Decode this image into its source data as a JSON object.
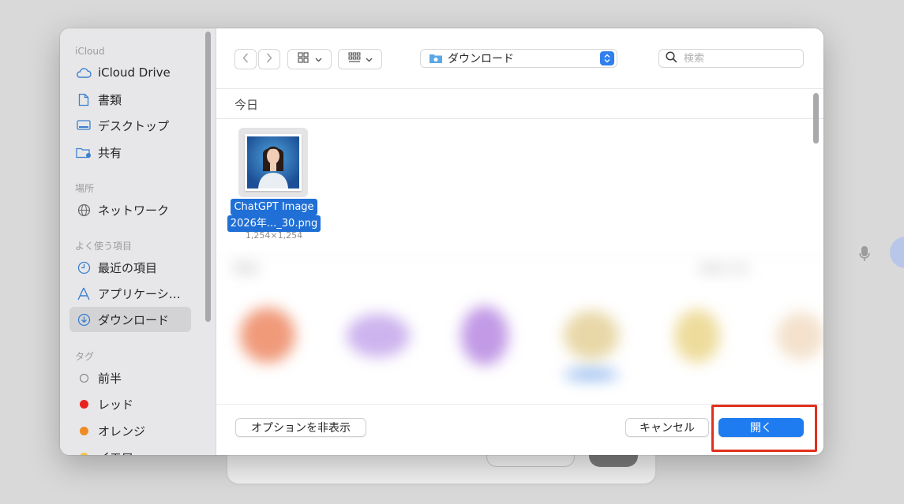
{
  "sidebar": {
    "sections": [
      {
        "title": "iCloud"
      },
      {
        "title": "場所"
      },
      {
        "title": "よく使う項目"
      },
      {
        "title": "タグ"
      }
    ],
    "items": [
      {
        "label": "iCloud Drive",
        "icon": "cloud-icon"
      },
      {
        "label": "書類",
        "icon": "document-icon"
      },
      {
        "label": "デスクトップ",
        "icon": "desktop-icon"
      },
      {
        "label": "共有",
        "icon": "shared-folder-icon"
      },
      {
        "label": "ネットワーク",
        "icon": "globe-icon"
      },
      {
        "label": "最近の項目",
        "icon": "clock-icon"
      },
      {
        "label": "アプリケーシ…",
        "icon": "applications-icon"
      },
      {
        "label": "ダウンロード",
        "icon": "download-icon",
        "selected": true
      },
      {
        "label": "前半",
        "icon": "tag-empty-icon"
      },
      {
        "label": "レッド",
        "icon": "tag-red-icon",
        "color": "#e8231e"
      },
      {
        "label": "オレンジ",
        "icon": "tag-orange-icon",
        "color": "#f08a24"
      },
      {
        "label": "イエロ",
        "icon": "tag-yellow-icon",
        "color": "#f5c33b"
      }
    ]
  },
  "toolbar": {
    "current_folder": "ダウンロード",
    "search_placeholder": "検索"
  },
  "content": {
    "today_label": "今日",
    "files": [
      {
        "name_line1": "ChatGPT Image",
        "name_line2": "2026年..._30.png",
        "dimensions": "1,254×1,254",
        "selected": true
      }
    ],
    "yesterday_label": "昨日",
    "show_more": "を表示 (24)"
  },
  "footer": {
    "options_button": "オプションを非表示",
    "cancel_button": "キャンセル",
    "open_button": "開く"
  },
  "colors": {
    "accent": "#1e7cf0",
    "highlight": "#e0301e"
  }
}
